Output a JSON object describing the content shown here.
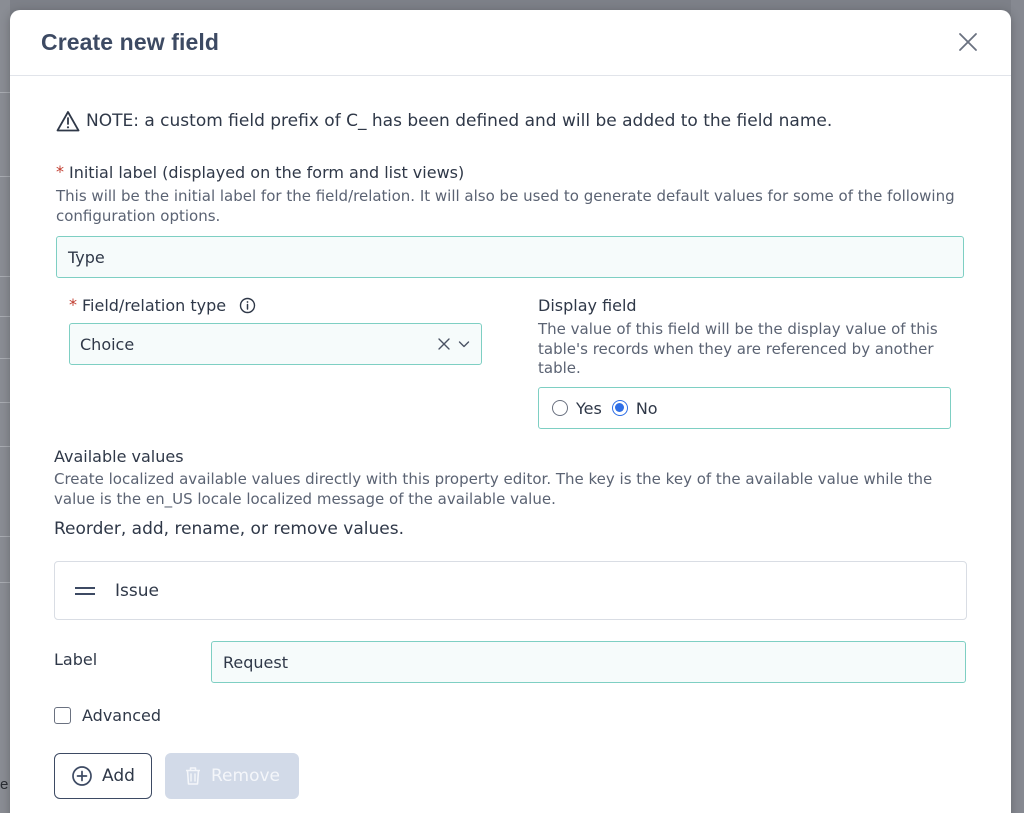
{
  "dialog": {
    "title": "Create new field",
    "close_icon": "close-icon"
  },
  "note": {
    "icon": "warning-icon",
    "text": "NOTE: a custom field prefix of C_ has been defined and will be added to the field name."
  },
  "initial_label": {
    "required_mark": "*",
    "label": "Initial label (displayed on the form and list views)",
    "help": "This will be the initial label for the field/relation. It will also be used to generate default values for some of the following configuration options.",
    "value": "Type"
  },
  "field_type": {
    "required_mark": "*",
    "label": "Field/relation type",
    "info_icon": "info-icon",
    "selected": "Choice",
    "clear_icon": "clear-icon",
    "chevron_icon": "chevron-down-icon"
  },
  "display_field": {
    "label": "Display field",
    "help": "The value of this field will be the display value of this table's records when they are referenced by another table.",
    "options": [
      "Yes",
      "No"
    ],
    "selected": "No"
  },
  "available_values": {
    "label": "Available values",
    "help": "Create localized available values directly with this property editor. The key is the key of the available value while the value is the en_US locale localized message of the available value.",
    "instruction": "Reorder, add, rename, or remove values.",
    "items": [
      {
        "name": "Issue"
      }
    ],
    "label_field_label": "Label",
    "label_field_value": "Request",
    "advanced_label": "Advanced",
    "advanced_checked": false,
    "add_label": "Add",
    "remove_label": "Remove"
  },
  "colors": {
    "accent": "#2f6fe6",
    "input_border": "#7ecfc3",
    "required": "#c0392b",
    "title": "#3d4a63",
    "disabled_button": "#d2dae8"
  },
  "background": {
    "edge_letter": "e"
  }
}
